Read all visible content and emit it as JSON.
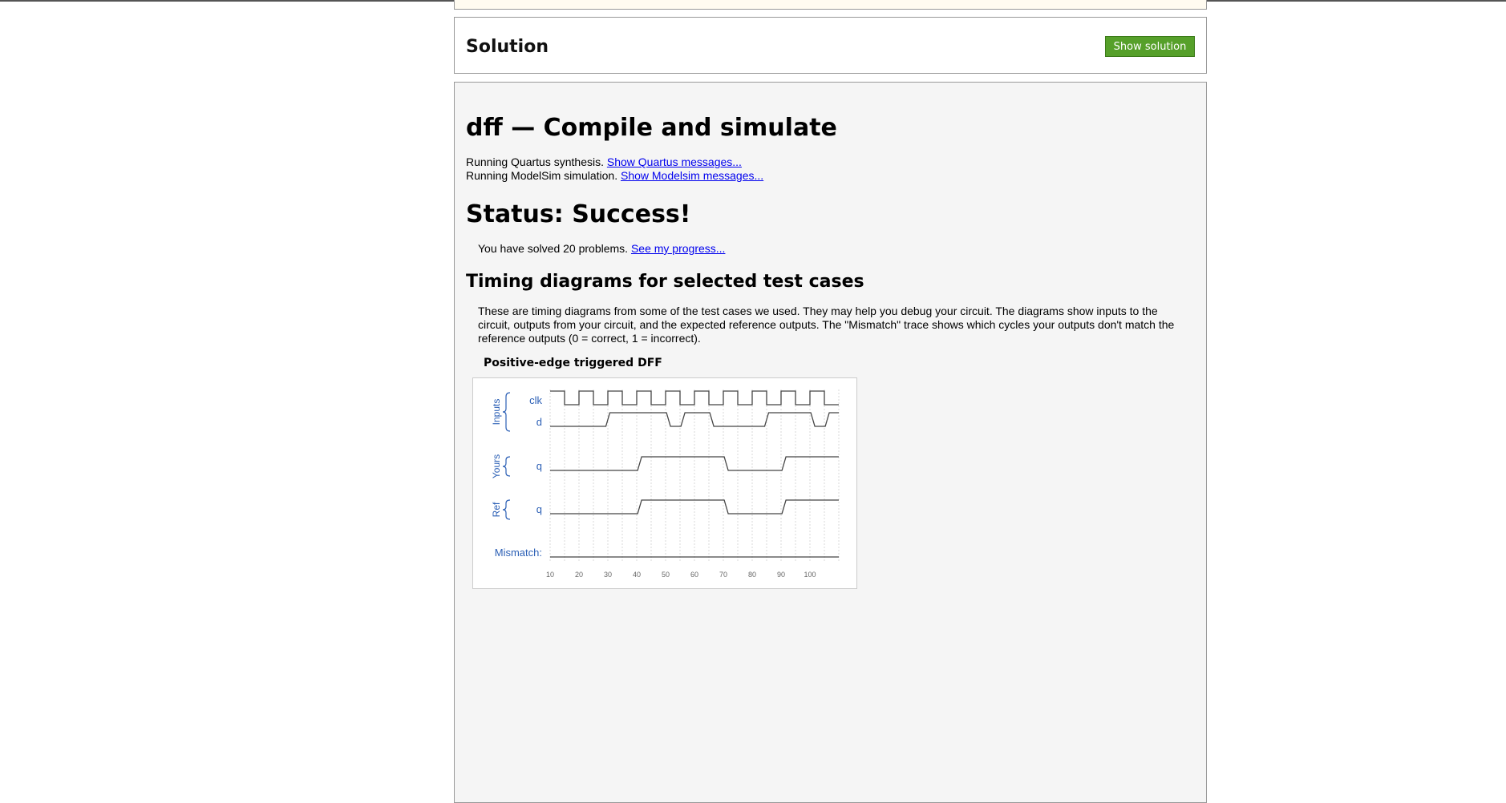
{
  "solution": {
    "title": "Solution",
    "button": "Show solution"
  },
  "sim": {
    "title": "dff — Compile and simulate",
    "quartus_text": "Running Quartus synthesis.",
    "quartus_link": "Show Quartus messages...",
    "modelsim_text": "Running ModelSim simulation.",
    "modelsim_link": "Show Modelsim messages...",
    "status": "Status: Success!",
    "progress_text": "You have solved 20 problems.",
    "progress_link": "See my progress...",
    "timing_heading": "Timing diagrams for selected test cases",
    "description": "These are timing diagrams from some of the test cases we used. They may help you debug your circuit. The diagrams show inputs to the circuit, outputs from your circuit, and the expected reference outputs. The \"Mismatch\" trace shows which cycles your outputs don't match the reference outputs (0 = correct, 1 = incorrect)."
  },
  "diagram": {
    "title": "Positive-edge triggered DFF",
    "groups": {
      "inputs": "Inputs",
      "yours": "Yours",
      "ref": "Ref"
    },
    "mismatch_label": "Mismatch:",
    "time_start": 10,
    "time_end": 110,
    "ticks": [
      "10",
      "20",
      "30",
      "40",
      "50",
      "60",
      "70",
      "80",
      "90",
      "100"
    ],
    "signals": [
      {
        "key": "clk",
        "label": "clk",
        "group": "inputs",
        "period": 10,
        "high_first": true
      },
      {
        "key": "d",
        "label": "d",
        "group": "inputs",
        "events": [
          [
            10,
            0
          ],
          [
            30,
            1
          ],
          [
            51,
            0
          ],
          [
            56,
            1
          ],
          [
            66,
            0
          ],
          [
            85,
            1
          ],
          [
            101,
            0
          ],
          [
            106,
            1
          ]
        ]
      },
      {
        "key": "yours_q",
        "label": "q",
        "group": "yours",
        "events": [
          [
            10,
            0
          ],
          [
            41,
            1
          ],
          [
            71,
            0
          ],
          [
            91,
            1
          ]
        ]
      },
      {
        "key": "ref_q",
        "label": "q",
        "group": "ref",
        "events": [
          [
            10,
            0
          ],
          [
            41,
            1
          ],
          [
            71,
            0
          ],
          [
            91,
            1
          ]
        ]
      },
      {
        "key": "mismatch",
        "label": "",
        "group": "mismatch",
        "events": [
          [
            10,
            0
          ]
        ]
      }
    ]
  },
  "colors": {
    "button": "#56a02a",
    "link": "#0000ee",
    "diagram_label": "#2b5fb5",
    "panel_bg": "#f5f5f5"
  }
}
